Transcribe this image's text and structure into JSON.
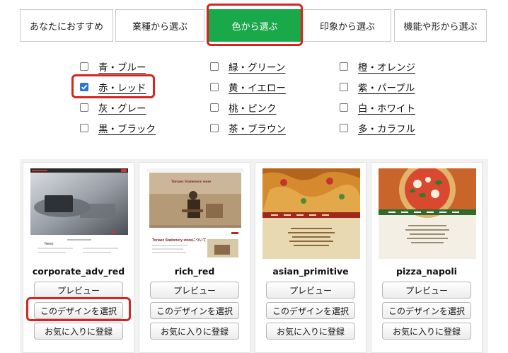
{
  "tabs": [
    {
      "label": "あなたにおすすめ",
      "active": false
    },
    {
      "label": "業種から選ぶ",
      "active": false
    },
    {
      "label": "色から選ぶ",
      "active": true
    },
    {
      "label": "印象から選ぶ",
      "active": false
    },
    {
      "label": "機能や形から選ぶ",
      "active": false
    }
  ],
  "colors": [
    {
      "label": "青・ブルー",
      "checked": false
    },
    {
      "label": "緑・グリーン",
      "checked": false
    },
    {
      "label": "橙・オレンジ",
      "checked": false
    },
    {
      "label": "赤・レッド",
      "checked": true
    },
    {
      "label": "黄・イエロー",
      "checked": false
    },
    {
      "label": "紫・パープル",
      "checked": false
    },
    {
      "label": "灰・グレー",
      "checked": false
    },
    {
      "label": "桃・ピンク",
      "checked": false
    },
    {
      "label": "白・ホワイト",
      "checked": false
    },
    {
      "label": "黒・ブラック",
      "checked": false
    },
    {
      "label": "茶・ブラウン",
      "checked": false
    },
    {
      "label": "多・カラフル",
      "checked": false
    }
  ],
  "cards": [
    {
      "name": "corporate_adv_red",
      "preview": "プレビュー",
      "select": "このデザインを選択",
      "favorite": "お気に入りに登録"
    },
    {
      "name": "rich_red",
      "preview": "プレビュー",
      "select": "このデザインを選択",
      "favorite": "お気に入りに登録"
    },
    {
      "name": "asian_primitive",
      "preview": "プレビュー",
      "select": "このデザインを選択",
      "favorite": "お気に入りに登録"
    },
    {
      "name": "pizza_napoli",
      "preview": "プレビュー",
      "select": "このデザインを選択",
      "favorite": "お気に入りに登録"
    }
  ],
  "thumbs": {
    "rich_red_store": "Toriaez Stationery store",
    "rich_red_about": "Toriaez Stationery storeについて",
    "corporate_news": "News"
  },
  "accent_colors": {
    "tab_active": "#19a84a",
    "highlight": "#d8231f",
    "checkbox": "#2b74d8"
  }
}
